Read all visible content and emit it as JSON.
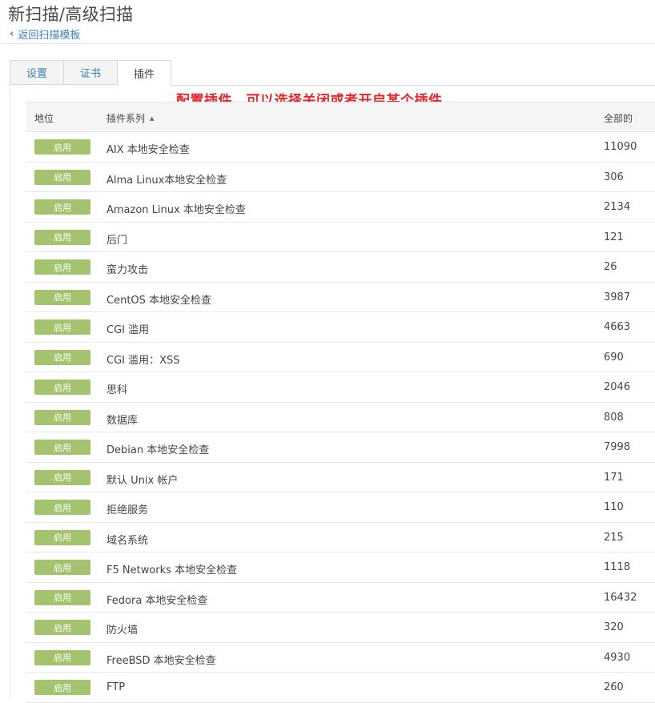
{
  "page": {
    "title": "新扫描/高级扫描",
    "back_label": "返回扫描模板"
  },
  "tabs": [
    {
      "label": "设置",
      "active": false
    },
    {
      "label": "证书",
      "active": false
    },
    {
      "label": "插件",
      "active": true
    }
  ],
  "annotation": "配置插件，可以选择关闭或者开启某个插件",
  "table": {
    "headers": {
      "status": "地位",
      "family": "插件系列",
      "total": "全部的"
    },
    "sort_indicator": "▲",
    "rows": [
      {
        "status": "启用",
        "family": "AIX 本地安全检查",
        "count": "11090"
      },
      {
        "status": "启用",
        "family": "Alma Linux本地安全检查",
        "count": "306"
      },
      {
        "status": "启用",
        "family": "Amazon Linux 本地安全检查",
        "count": "2134"
      },
      {
        "status": "启用",
        "family": "后门",
        "count": "121"
      },
      {
        "status": "启用",
        "family": "蛮力攻击",
        "count": "26"
      },
      {
        "status": "启用",
        "family": "CentOS 本地安全检查",
        "count": "3987"
      },
      {
        "status": "启用",
        "family": "CGI 滥用",
        "count": "4663"
      },
      {
        "status": "启用",
        "family": "CGI 滥用：XSS",
        "count": "690"
      },
      {
        "status": "启用",
        "family": "思科",
        "count": "2046"
      },
      {
        "status": "启用",
        "family": "数据库",
        "count": "808"
      },
      {
        "status": "启用",
        "family": "Debian 本地安全检查",
        "count": "7998"
      },
      {
        "status": "启用",
        "family": "默认 Unix 帐户",
        "count": "171"
      },
      {
        "status": "启用",
        "family": "拒绝服务",
        "count": "110"
      },
      {
        "status": "启用",
        "family": "域名系统",
        "count": "215"
      },
      {
        "status": "启用",
        "family": "F5 Networks 本地安全检查",
        "count": "1118"
      },
      {
        "status": "启用",
        "family": "Fedora 本地安全检查",
        "count": "16432"
      },
      {
        "status": "启用",
        "family": "防火墙",
        "count": "320"
      },
      {
        "status": "启用",
        "family": "FreeBSD 本地安全检查",
        "count": "4930"
      },
      {
        "status": "启用",
        "family": "FTP",
        "count": "260"
      }
    ]
  },
  "colors": {
    "enabled_button": "#a3c36e",
    "link": "#3c7fb4",
    "annotation": "#e8252a"
  },
  "icons": {
    "back": "chevron-left-icon"
  }
}
